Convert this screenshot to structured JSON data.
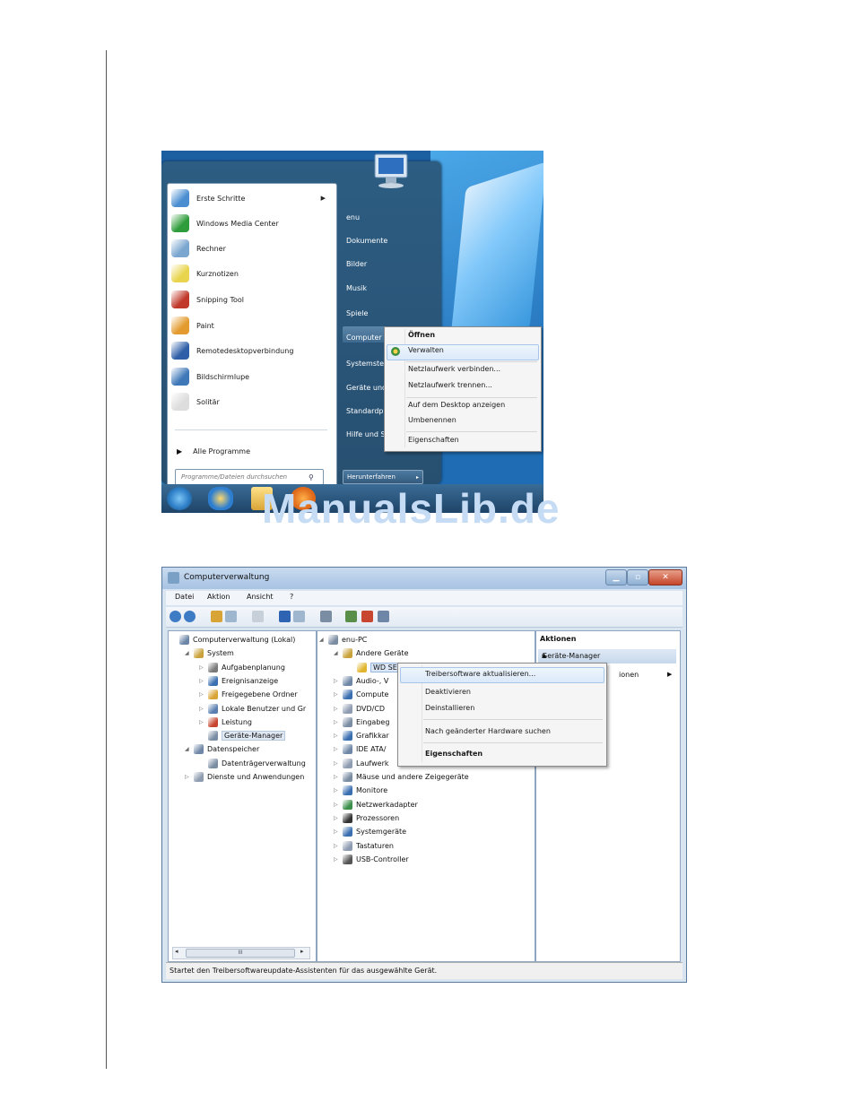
{
  "start_menu": {
    "programs": [
      {
        "label": "Erste Schritte",
        "icon": "getting-started-icon",
        "color": "#4a8ed1",
        "submenu": true
      },
      {
        "label": "Windows Media Center",
        "icon": "media-center-icon",
        "color": "#2e9c3a",
        "submenu": false
      },
      {
        "label": "Rechner",
        "icon": "calculator-icon",
        "color": "#7aa6cf",
        "submenu": false
      },
      {
        "label": "Kurznotizen",
        "icon": "sticky-notes-icon",
        "color": "#e8d44d",
        "submenu": false
      },
      {
        "label": "Snipping Tool",
        "icon": "snipping-tool-icon",
        "color": "#c0392b",
        "submenu": false
      },
      {
        "label": "Paint",
        "icon": "paint-icon",
        "color": "#e39b2f",
        "submenu": false
      },
      {
        "label": "Remotedesktopverbindung",
        "icon": "remote-desktop-icon",
        "color": "#2f5fa8",
        "submenu": false
      },
      {
        "label": "Bildschirmlupe",
        "icon": "magnifier-icon",
        "color": "#3f78b8",
        "submenu": false
      },
      {
        "label": "Solitär",
        "icon": "solitaire-icon",
        "color": "#dddddd",
        "submenu": false
      }
    ],
    "all_programs": "Alle Programme",
    "search_placeholder": "Programme/Dateien durchsuchen",
    "right_items": [
      "enu",
      "Dokumente",
      "Bilder",
      "Musik",
      "Spiele",
      "Computer",
      "Systemsteu",
      "Geräte und",
      "Standardp",
      "Hilfe und S"
    ],
    "shutdown": "Herunterfahren",
    "context_menu": [
      "Öffnen",
      "Verwalten",
      "Netzlaufwerk verbinden...",
      "Netzlaufwerk trennen...",
      "Auf dem Desktop anzeigen",
      "Umbenennen",
      "Eigenschaften"
    ]
  },
  "watermark": "ManualsLib.de",
  "computer_management": {
    "title": "Computerverwaltung",
    "menu": [
      "Datei",
      "Aktion",
      "Ansicht",
      "?"
    ],
    "left_tree": [
      {
        "label": "Computerverwaltung (Lokal)",
        "indent": 0,
        "exp": "",
        "color": "#6b86a6"
      },
      {
        "label": "System",
        "indent": 1,
        "exp": "◢",
        "color": "#c9a23c"
      },
      {
        "label": "Aufgabenplanung",
        "indent": 2,
        "exp": "▷",
        "color": "#7a7a7a"
      },
      {
        "label": "Ereignisanzeige",
        "indent": 2,
        "exp": "▷",
        "color": "#3a6fb0"
      },
      {
        "label": "Freigegebene Ordner",
        "indent": 2,
        "exp": "▷",
        "color": "#d9a436"
      },
      {
        "label": "Lokale Benutzer und Gr",
        "indent": 2,
        "exp": "▷",
        "color": "#5a7fb0"
      },
      {
        "label": "Leistung",
        "indent": 2,
        "exp": "▷",
        "color": "#c8462f"
      },
      {
        "label": "Geräte-Manager",
        "indent": 2,
        "exp": "",
        "color": "#7b8da3"
      },
      {
        "label": "Datenspeicher",
        "indent": 1,
        "exp": "◢",
        "color": "#6f87a6"
      },
      {
        "label": "Datenträgerverwaltung",
        "indent": 2,
        "exp": "",
        "color": "#7b8da3"
      },
      {
        "label": "Dienste und Anwendungen",
        "indent": 1,
        "exp": "▷",
        "color": "#8e9bb0"
      }
    ],
    "device_tree": [
      {
        "label": "enu-PC",
        "indent": 0,
        "exp": "◢",
        "color": "#7b8da3"
      },
      {
        "label": "Andere Geräte",
        "indent": 1,
        "exp": "◢",
        "color": "#c9a23c"
      },
      {
        "label": "WD SES D",
        "indent": 2,
        "exp": "",
        "color": "#e0b42c"
      },
      {
        "label": "Audio-, V",
        "indent": 1,
        "exp": "▷",
        "color": "#6f87a6"
      },
      {
        "label": "Compute",
        "indent": 1,
        "exp": "▷",
        "color": "#3a6fb0"
      },
      {
        "label": "DVD/CD",
        "indent": 1,
        "exp": "▷",
        "color": "#8e9bb0"
      },
      {
        "label": "Eingabeg",
        "indent": 1,
        "exp": "▷",
        "color": "#7b8da3"
      },
      {
        "label": "Grafikkar",
        "indent": 1,
        "exp": "▷",
        "color": "#3a6fb0"
      },
      {
        "label": "IDE ATA/",
        "indent": 1,
        "exp": "▷",
        "color": "#6f87a6"
      },
      {
        "label": "Laufwerk",
        "indent": 1,
        "exp": "▷",
        "color": "#8e9bb0"
      },
      {
        "label": "Mäuse und andere Zeigegeräte",
        "indent": 1,
        "exp": "▷",
        "color": "#7b8da3"
      },
      {
        "label": "Monitore",
        "indent": 1,
        "exp": "▷",
        "color": "#3a6fb0"
      },
      {
        "label": "Netzwerkadapter",
        "indent": 1,
        "exp": "▷",
        "color": "#3a8f4a"
      },
      {
        "label": "Prozessoren",
        "indent": 1,
        "exp": "▷",
        "color": "#333333"
      },
      {
        "label": "Systemgeräte",
        "indent": 1,
        "exp": "▷",
        "color": "#3a6fb0"
      },
      {
        "label": "Tastaturen",
        "indent": 1,
        "exp": "▷",
        "color": "#8e9bb0"
      },
      {
        "label": "USB-Controller",
        "indent": 1,
        "exp": "▷",
        "color": "#555555"
      }
    ],
    "actions": {
      "header": "Aktionen",
      "selected": "Geräte-Manager",
      "more": "ionen"
    },
    "context_menu": [
      "Treibersoftware aktualisieren...",
      "Deaktivieren",
      "Deinstallieren",
      "Nach geänderter Hardware suchen",
      "Eigenschaften"
    ],
    "status": "Startet den Treibersoftwareupdate-Assistenten für das ausgewählte Gerät.",
    "scroll_thumb": "III"
  }
}
